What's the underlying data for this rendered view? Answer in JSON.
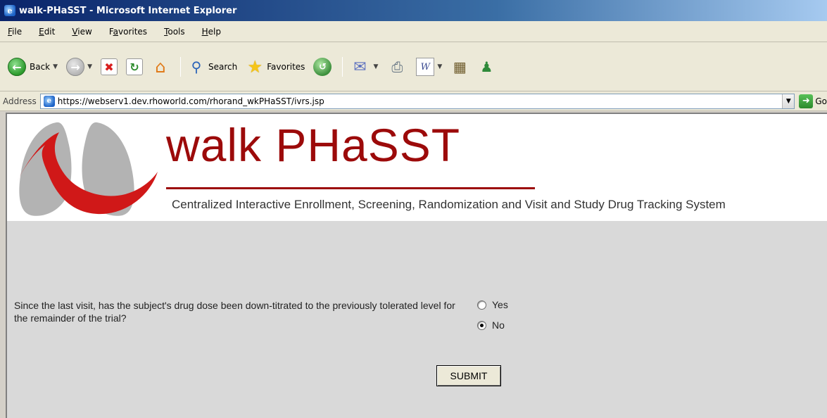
{
  "window": {
    "title": "walk-PHaSST - Microsoft Internet Explorer"
  },
  "menu": [
    "File",
    "Edit",
    "View",
    "Favorites",
    "Tools",
    "Help"
  ],
  "menu_underlines": [
    "F",
    "E",
    "V",
    "a",
    "T",
    "H"
  ],
  "toolbar": {
    "back_label": "Back",
    "search_label": "Search",
    "favorites_label": "Favorites"
  },
  "address": {
    "label": "Address",
    "url": "https://webserv1.dev.rhoworld.com/rhorand_wkPHaSST/ivrs.jsp",
    "go_label": "Go"
  },
  "banner": {
    "title": "walk PHaSST",
    "subtitle": "Centralized Interactive Enrollment, Screening, Randomization and Visit and Study Drug Tracking System"
  },
  "form": {
    "question": "Since the last visit, has the subject's drug dose been down-titrated to the previously tolerated level for the remainder of the trial?",
    "options": [
      {
        "label": "Yes",
        "selected": false
      },
      {
        "label": "No",
        "selected": true
      }
    ],
    "submit_label": "SUBMIT"
  },
  "colors": {
    "brand_red": "#9c0a0a",
    "content_bg": "#d9d9d9",
    "chrome_bg": "#ece9d8"
  }
}
